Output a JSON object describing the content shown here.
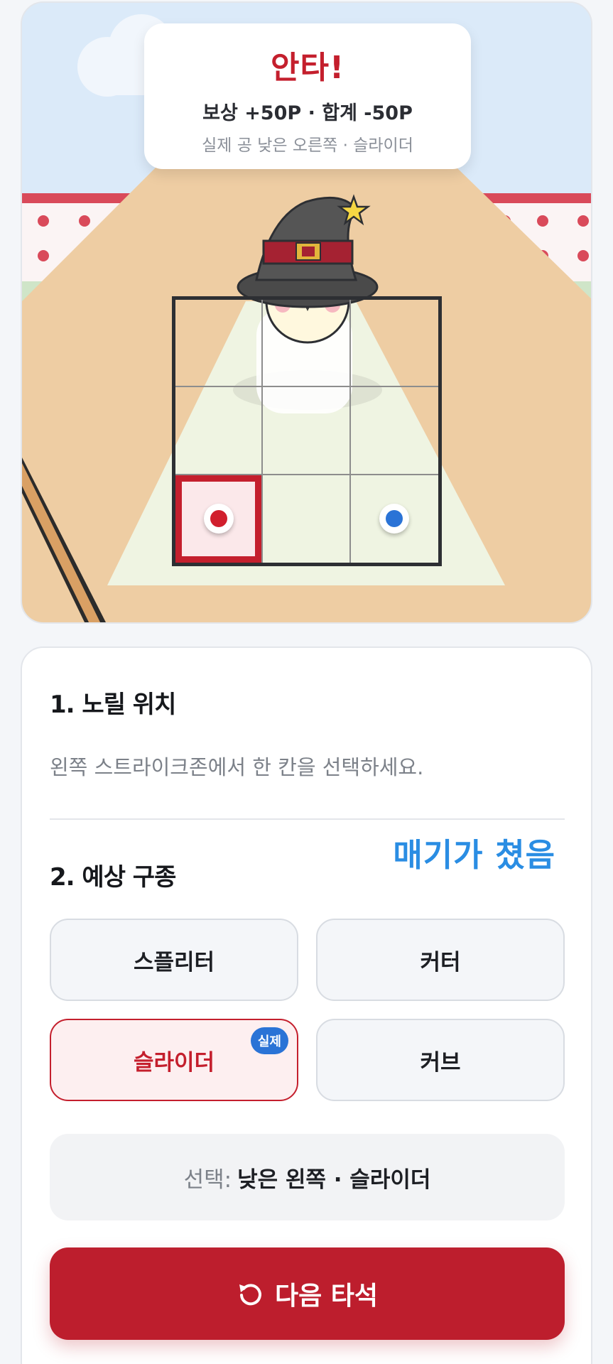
{
  "result": {
    "title": "안타!",
    "summary": "보상 +50P · 합계 -50P",
    "actual_pitch": "실제 공 낮은 오른쪽 · 슬라이더"
  },
  "zone": {
    "selected_cell": "bottom-left",
    "guess_marker_color": "#d11f2d",
    "actual_marker_color": "#2a73d6"
  },
  "panel": {
    "section1_title": "1. 노릴 위치",
    "section1_hint": "왼쪽 스트라이크존에서 한 칸을 선택하세요.",
    "pitcher_status": "매기가 쳤음",
    "section2_title": "2. 예상 구종",
    "pitches": [
      {
        "label": "스플리터"
      },
      {
        "label": "커터"
      },
      {
        "label": "슬라이더",
        "badge": "실제"
      },
      {
        "label": "커브"
      }
    ],
    "selection_prefix": "선택:",
    "selection_value": "낮은 왼쪽 · 슬라이더",
    "next_button": "다음 타석"
  },
  "colors": {
    "accent_red": "#bd1e2d",
    "accent_blue": "#2a8de3"
  }
}
